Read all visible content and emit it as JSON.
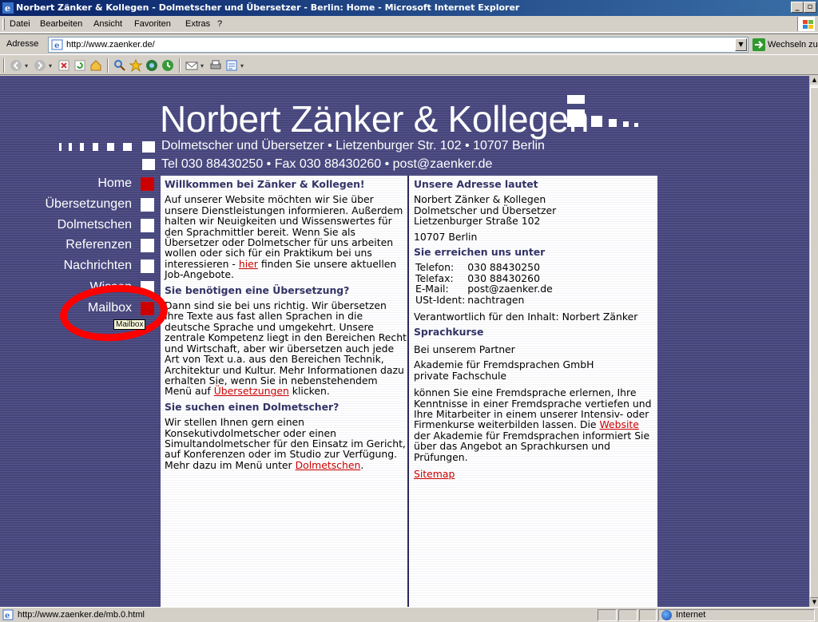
{
  "window": {
    "title": "Norbert Zänker & Kollegen - Dolmetscher und Übersetzer - Berlin: Home - Microsoft Internet Explorer",
    "controls": [
      "_",
      "\u0001",
      "×"
    ]
  },
  "menu": {
    "items": [
      "Datei",
      "Bearbeiten",
      "Ansicht",
      "Favoriten",
      "Extras",
      "?"
    ]
  },
  "address": {
    "label": "Adresse",
    "url": "http://www.zaenker.de/",
    "go_label": "Wechseln zu"
  },
  "toolbar": {
    "icons": [
      "back-icon",
      "forward-icon",
      "stop-icon",
      "refresh-icon",
      "home-icon",
      "search-icon",
      "favorites-icon",
      "media-icon",
      "history-icon",
      "mail-icon",
      "print-icon",
      "edit-icon"
    ]
  },
  "site": {
    "title": "Norbert Zänker & Kollegen",
    "subtitle": "Dolmetscher und Übersetzer • Lietzenburger Str. 102 • 10707 Berlin",
    "contact_line": "Tel 030 88430250 • Fax 030 88430260 • post@zaenker.de",
    "accent_color": "#cc0000",
    "background_color": "#4a4a82"
  },
  "nav": {
    "items": [
      {
        "label": "Home",
        "active": true
      },
      {
        "label": "Übersetzungen",
        "active": false
      },
      {
        "label": "Dolmetschen",
        "active": false
      },
      {
        "label": "Referenzen",
        "active": false
      },
      {
        "label": "Nachrichten",
        "active": false
      },
      {
        "label": "Wissen",
        "active": false
      },
      {
        "label": "Mailbox",
        "active": true
      }
    ],
    "tooltip": "Mailbox"
  },
  "left": {
    "h1": "Willkommen bei Zänker & Kollegen!",
    "p1_a": "Auf unserer Website möchten wir Sie über unsere Dienstleistungen informieren. Außerdem halten wir Neuigkeiten und Wissenswertes für den Sprachmittler bereit. Wenn Sie als Übersetzer oder Dolmetscher für uns arbeiten wollen oder sich für ein Praktikum bei uns interessieren - ",
    "p1_link": "hier",
    "p1_b": " finden Sie unsere aktuellen Job-Angebote.",
    "h2": "Sie benötigen eine Übersetzung?",
    "p2_a": "Dann sind sie bei uns richtig. Wir übersetzen Ihre Texte aus fast allen Sprachen in die deutsche Sprache und umgekehrt. Unsere zentrale Kompetenz liegt in den Bereichen Recht und Wirtschaft, aber wir übersetzen auch jede Art von Text u.a. aus den Bereichen Technik, Architektur und Kultur. Mehr Informationen dazu erhalten Sie, wenn Sie in nebenstehendem Menü auf ",
    "p2_link": "Übersetzungen",
    "p2_b": " klicken.",
    "h3": "Sie suchen einen Dolmetscher?",
    "p3_a": "Wir stellen Ihnen gern einen Konsekutivdolmetscher oder einen Simultandolmetscher für den Einsatz im Gericht, auf Konferenzen oder im Studio zur Verfügung. Mehr dazu im Menü unter ",
    "p3_link": "Dolmetschen",
    "p3_b": "."
  },
  "right": {
    "h1": "Unsere Adresse lautet",
    "addr1": "Norbert Zänker & Kollegen",
    "addr2": "Dolmetscher und Übersetzer",
    "addr3": "Lietzenburger Straße 102",
    "addr4": "10707 Berlin",
    "h2": "Sie erreichen uns unter",
    "contact": [
      {
        "k": "Telefon:",
        "v": "030 88430250"
      },
      {
        "k": "Telefax:",
        "v": "030 88430260"
      },
      {
        "k": "E-Mail:",
        "v": "post@zaenker.de"
      },
      {
        "k": "USt-Ident:",
        "v": "nachtragen"
      }
    ],
    "responsible": "Verantwortlich für den Inhalt: Norbert Zänker",
    "h3": "Sprachkurse",
    "partner": "Bei unserem Partner",
    "school1": "Akademie für Fremdsprachen GmbH",
    "school2": "private Fachschule",
    "p_a": "können Sie eine Fremdsprache erlernen, Ihre Kenntnisse in einer Fremdsprache vertiefen und Ihre Mitarbeiter in einem unserer Intensiv- oder Firmenkurse weiterbilden lassen. Die ",
    "p_link": "Website",
    "p_b": " der Akademie für Fremdsprachen informiert Sie über das Angebot an Sprachkursen und Prüfungen.",
    "sitemap": "Sitemap"
  },
  "status": {
    "text": "http://www.zaenker.de/mb.0.html",
    "zone": "Internet"
  }
}
